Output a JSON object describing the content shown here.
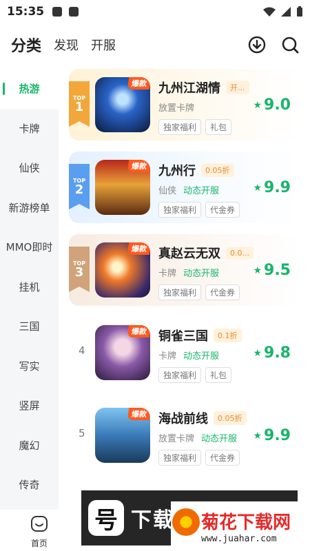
{
  "status_bar": {
    "time": "15:35"
  },
  "header": {
    "tabs": [
      {
        "label": "分类",
        "active": true
      },
      {
        "label": "发现",
        "active": false
      },
      {
        "label": "开服",
        "active": false
      }
    ],
    "download_icon": "download-circle-icon",
    "search_icon": "search-icon"
  },
  "sidebar": {
    "items": [
      "热游",
      "卡牌",
      "仙侠",
      "新游榜单",
      "MMO即时",
      "挂机",
      "三国",
      "写实",
      "竖屏",
      "魔幻",
      "传奇"
    ],
    "active_index": 0
  },
  "games": [
    {
      "rank": "1",
      "rank_prefix": "TOP",
      "badge": "爆款",
      "title": "九州江湖情",
      "discount": "开...",
      "category": "放置卡牌",
      "open_label": "",
      "tags": [
        "独家福利",
        "礼包"
      ],
      "score": "9.0"
    },
    {
      "rank": "2",
      "rank_prefix": "TOP",
      "badge": "爆款",
      "title": "九州行",
      "discount": "0.05折",
      "category": "仙侠",
      "open_label": "动态开服",
      "tags": [
        "独家福利",
        "代金券"
      ],
      "score": "9.9"
    },
    {
      "rank": "3",
      "rank_prefix": "TOP",
      "badge": "爆款",
      "title": "真赵云无双",
      "discount": "0.0...",
      "category": "卡牌",
      "open_label": "动态开服",
      "tags": [
        "独家福利",
        "代金券"
      ],
      "score": "9.5"
    },
    {
      "rank": "4",
      "rank_prefix": "",
      "badge": "爆款",
      "title": "铜雀三国",
      "discount": "0.1折",
      "category": "卡牌",
      "open_label": "动态开服",
      "tags": [
        "独家福利",
        "礼包"
      ],
      "score": "9.8"
    },
    {
      "rank": "5",
      "rank_prefix": "",
      "badge": "爆款",
      "title": "海战前线",
      "discount": "0.05折",
      "category": "放置卡牌",
      "open_label": "动态开服",
      "tags": [
        "独家福利",
        "代金券"
      ],
      "score": "9.9"
    }
  ],
  "bottom_nav": {
    "home_label": "首页"
  },
  "watermark": {
    "text": "下载宝资源",
    "logo_char": "号"
  },
  "brand": {
    "name": "菊花下载网",
    "url": "www.juahar.com"
  },
  "colors": {
    "accent": "#19b56a",
    "discount": "#e68a2e",
    "badge": "#ff5a1f"
  }
}
